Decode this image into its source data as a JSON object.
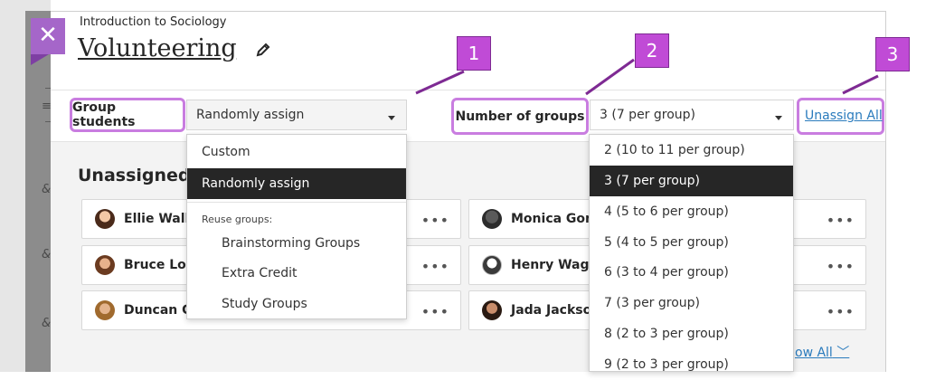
{
  "course_name": "Introduction to Sociology",
  "page_title": "Volunteering",
  "toolbar": {
    "group_students_label": "Group students",
    "group_method_value": "Randomly assign",
    "number_of_groups_label": "Number of groups",
    "number_of_groups_value": "3 (7 per group)",
    "unassign_all": "Unassign All"
  },
  "callouts": [
    "1",
    "2",
    "3"
  ],
  "section_title": "Unassigned s",
  "students": {
    "col1": [
      "Ellie Walke",
      "Bruce Lope",
      "Duncan Ca"
    ],
    "col3": [
      "Monica Gonz",
      "Henry Wagne",
      "Jada Jackson"
    ]
  },
  "show_all_link": "ow All",
  "method_menu": {
    "items": [
      "Custom",
      "Randomly assign"
    ],
    "selected": "Randomly assign",
    "reuse_caption": "Reuse groups:",
    "reuse_items": [
      "Brainstorming Groups",
      "Extra Credit",
      "Study Groups"
    ]
  },
  "groups_menu": {
    "options": [
      "2 (10 to 11 per group)",
      "3 (7 per group)",
      "4 (5 to 6 per group)",
      "5 (4 to 5 per group)",
      "6 (3 to 4 per group)",
      "7 (3 per group)",
      "8 (2 to 3 per group)",
      "9 (2 to 3 per group)"
    ],
    "selected": "3 (7 per group)"
  },
  "icons": {
    "close": "close-icon",
    "edit": "pencil-icon",
    "more": "more-options-icon",
    "dropdown": "caret-down-icon",
    "chevron": "chevron-down-icon"
  },
  "colors": {
    "highlight": "#c97de0",
    "callout": "#c04bd6",
    "close_button": "#a566c9",
    "selected_item": "#262626",
    "link": "#2a7bbd"
  }
}
